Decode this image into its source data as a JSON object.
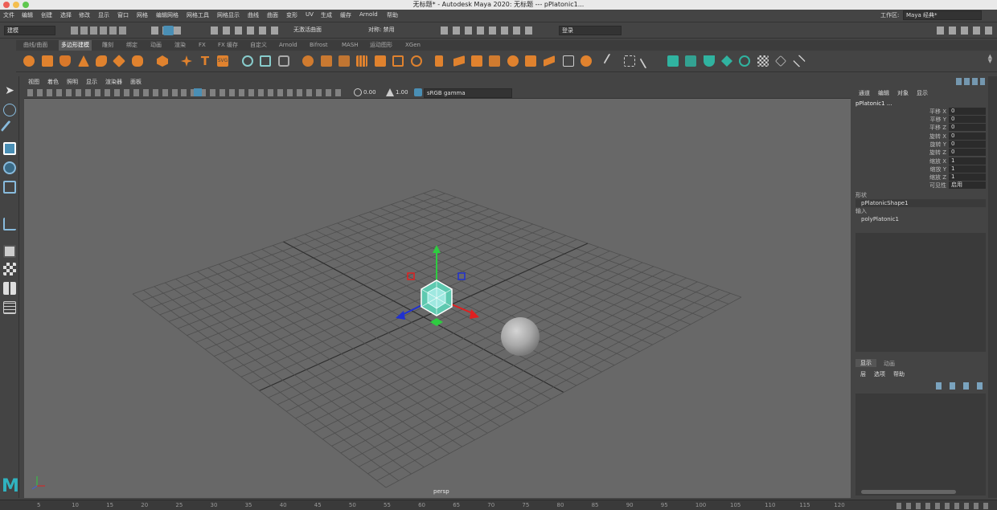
{
  "window": {
    "title": "无标题* - Autodesk Maya 2020: 无标题   ---   pPlatonic1..."
  },
  "menubar": {
    "items": [
      "文件",
      "编辑",
      "创建",
      "选择",
      "修改",
      "显示",
      "窗口",
      "网格",
      "编辑网格",
      "网格工具",
      "网格显示",
      "曲线",
      "曲面",
      "变形",
      "UV",
      "生成",
      "缓存",
      "Arnold",
      "帮助"
    ],
    "workspace_label": "工作区:",
    "workspace_value": "Maya 经典*"
  },
  "statusline": {
    "mode": "建模",
    "live_surface": "无激活曲面",
    "symmetry": "对称: 禁用",
    "login": "登录"
  },
  "shelf": {
    "tabs": [
      "曲线/曲面",
      "多边形建模",
      "雕刻",
      "绑定",
      "动画",
      "渲染",
      "FX",
      "FX 缓存",
      "自定义",
      "Arnold",
      "Bifrost",
      "MASH",
      "运动图形",
      "XGen"
    ],
    "active_tab": 1
  },
  "viewport": {
    "menus": [
      "视图",
      "着色",
      "照明",
      "显示",
      "渲染器",
      "面板"
    ],
    "exposure": "0.00",
    "gamma": "1.00",
    "color_space": "sRGB gamma",
    "camera_label": "persp"
  },
  "channelbox": {
    "tabs": [
      "通道",
      "编辑",
      "对象",
      "显示"
    ],
    "object_name": "pPlatonic1 ...",
    "channels": [
      {
        "label": "平移 X",
        "value": "0"
      },
      {
        "label": "平移 Y",
        "value": "0"
      },
      {
        "label": "平移 Z",
        "value": "0"
      },
      {
        "label": "旋转 X",
        "value": "0"
      },
      {
        "label": "旋转 Y",
        "value": "0"
      },
      {
        "label": "旋转 Z",
        "value": "0"
      },
      {
        "label": "缩放 X",
        "value": "1"
      },
      {
        "label": "缩放 Y",
        "value": "1"
      },
      {
        "label": "缩放 Z",
        "value": "1"
      },
      {
        "label": "可见性",
        "value": "启用"
      }
    ],
    "shapes_label": "形状",
    "shape_name": "pPlatonicShape1",
    "inputs_label": "输入",
    "input_name": "polyPlatonic1"
  },
  "layers": {
    "tabs": [
      "显示",
      "动画"
    ],
    "menus": [
      "层",
      "选项",
      "帮助"
    ]
  },
  "timeline": {
    "ticks": [
      "5",
      "10",
      "15",
      "20",
      "25",
      "30",
      "35",
      "40",
      "45",
      "50",
      "55",
      "60",
      "65",
      "70",
      "75",
      "80",
      "85",
      "90",
      "95",
      "100",
      "105",
      "110",
      "115",
      "120"
    ]
  },
  "colors": {
    "accent": "#e0822e",
    "panel": "#444444",
    "viewport": "#686868",
    "highlight": "#4a8fb5"
  }
}
